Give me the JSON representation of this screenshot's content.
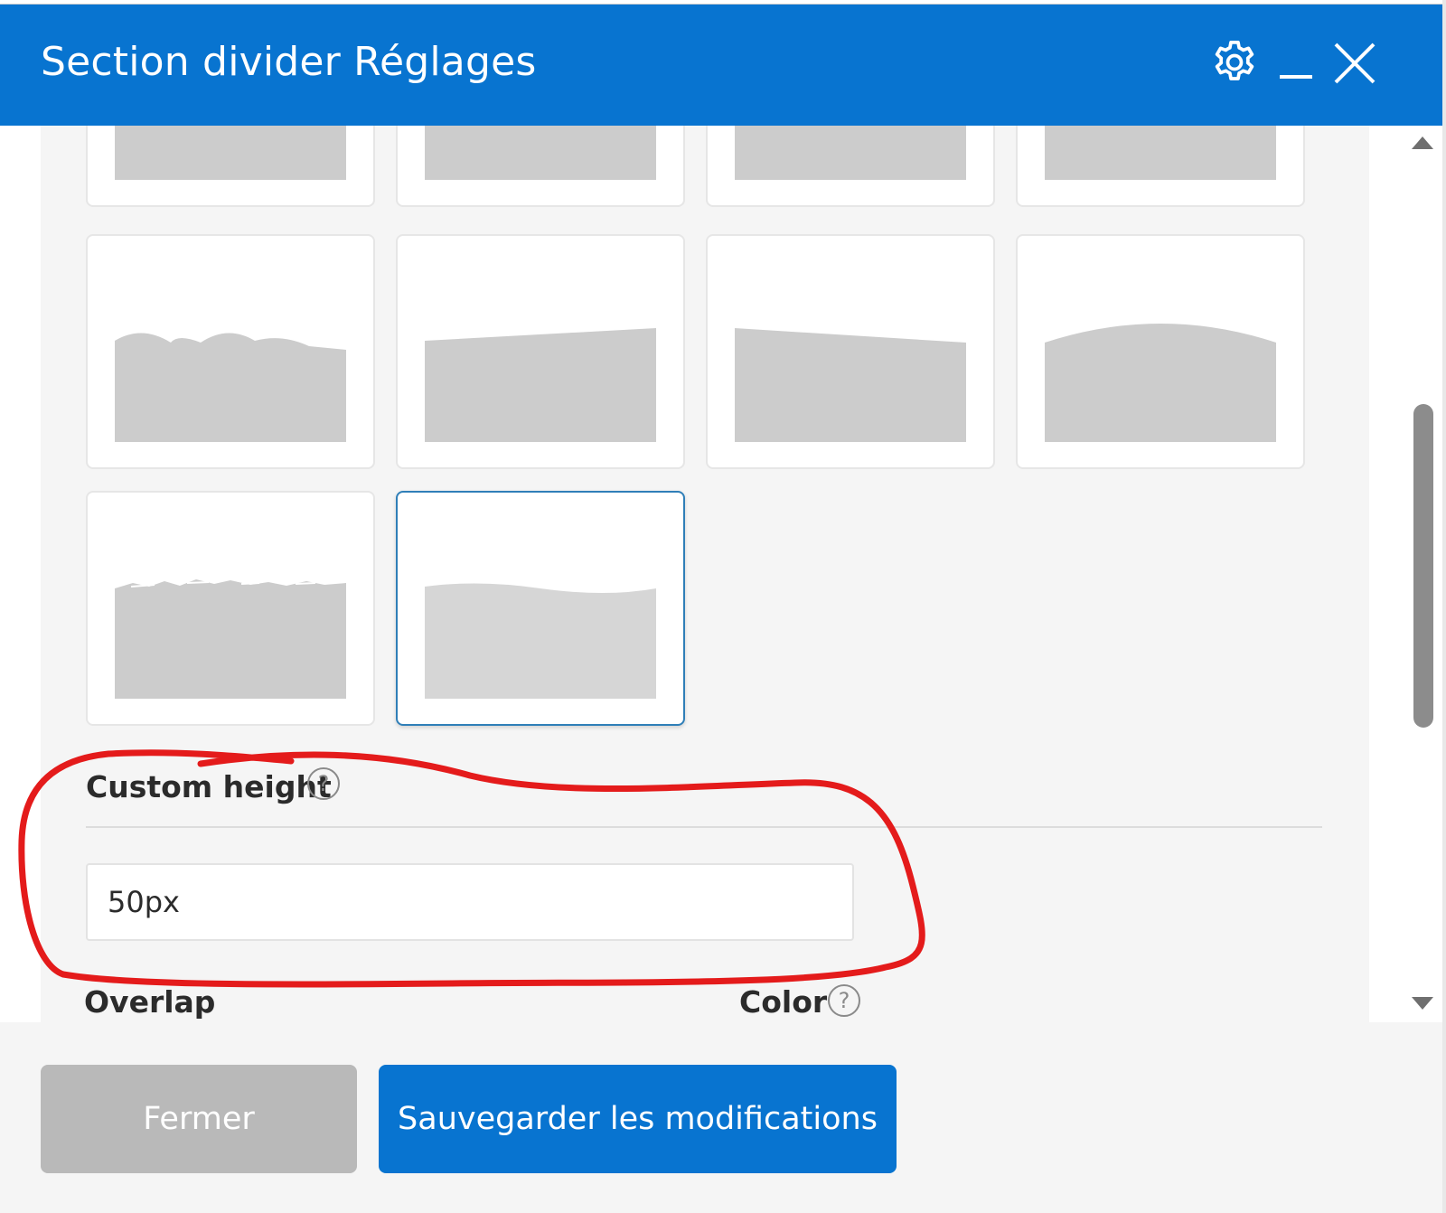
{
  "window": {
    "title": "Section divider Réglages",
    "settings_icon": "gear-icon",
    "minimize_icon": "minimize-icon",
    "close_icon": "close-icon",
    "title_bar_color": "#0874d0"
  },
  "divider_shapes": {
    "options": [
      {
        "shape": "flat",
        "row": 1
      },
      {
        "shape": "flat",
        "row": 1
      },
      {
        "shape": "flat",
        "row": 1
      },
      {
        "shape": "flat",
        "row": 1
      },
      {
        "shape": "clouds",
        "row": 2
      },
      {
        "shape": "slope-up",
        "row": 2
      },
      {
        "shape": "slope-down",
        "row": 2
      },
      {
        "shape": "arc",
        "row": 2
      },
      {
        "shape": "brush-stroke",
        "row": 3
      },
      {
        "shape": "wave",
        "row": 3,
        "selected": true
      }
    ],
    "shape_fill_color": "#cccccc",
    "selected_border_color": "#2f7fb8"
  },
  "custom_height": {
    "label": "Custom height",
    "help": "?",
    "value": "50px"
  },
  "cut_off_labels": {
    "overlap": "Overlap",
    "color": "Color",
    "color_help": "?"
  },
  "footer": {
    "close_label": "Fermer",
    "save_label": "Sauvegarder les modifications",
    "close_color": "#b9b9b9",
    "save_color": "#0874d0"
  },
  "annotation": {
    "color": "#e41b1b",
    "description_kind": "hand-drawn circle"
  }
}
